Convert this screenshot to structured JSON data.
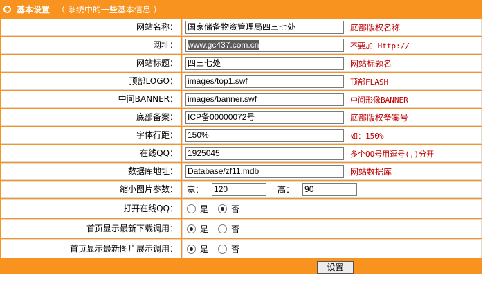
{
  "header": {
    "title": "基本设置",
    "subtitle": "（ 系统中的一些基本信息 ）"
  },
  "fields": [
    {
      "label": "网站名称：",
      "value": "国家储备物资管理局四三七处",
      "note": "底部版权名称",
      "note_type": "cn"
    },
    {
      "label": "网址：",
      "value": "www.gc437.com.cn",
      "note": "不要加 Http://",
      "note_type": "mono"
    },
    {
      "label": "网站标题：",
      "value": "四三七处",
      "note": "网站标题名",
      "note_type": "cn"
    },
    {
      "label": "顶部LOGO：",
      "value": "images/top1.swf",
      "note": "顶部FLASH",
      "note_type": "mono"
    },
    {
      "label": "中间BANNER：",
      "value": "images/banner.swf",
      "note": "中间形像BANNER",
      "note_type": "mono"
    },
    {
      "label": "底部备案：",
      "value": "ICP备00000072号",
      "note": "底部版权备案号",
      "note_type": "cn"
    },
    {
      "label": "字体行距：",
      "value": "150%",
      "note": "如：150%",
      "note_type": "mono"
    },
    {
      "label": "在线QQ：",
      "value": "1925045",
      "note": "多个QQ号用逗号(,)分开",
      "note_type": "mono"
    },
    {
      "label": "数据库地址：",
      "value": "Database/zf11.mdb",
      "note": "网站数据库",
      "note_type": "cn"
    }
  ],
  "thumb": {
    "label": "缩小图片参数：",
    "width_label": "宽：",
    "width_value": "120",
    "height_label": "高：",
    "height_value": "90"
  },
  "radios": [
    {
      "label": "打开在线QQ：",
      "yes": "是",
      "no": "否",
      "selected": "no"
    },
    {
      "label": "首页显示最新下载调用：",
      "yes": "是",
      "no": "否",
      "selected": "yes"
    },
    {
      "label": "首页显示最新图片展示调用：",
      "yes": "是",
      "no": "否",
      "selected": "yes"
    }
  ],
  "submit_label": "设置",
  "colors": {
    "accent": "#f7931e",
    "note": "#c00000"
  }
}
